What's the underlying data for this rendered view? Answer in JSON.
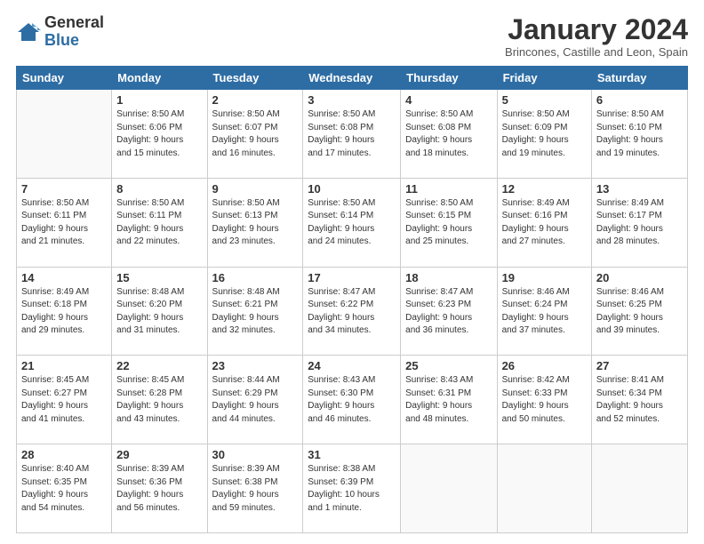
{
  "logo": {
    "general": "General",
    "blue": "Blue"
  },
  "header": {
    "month": "January 2024",
    "location": "Brincones, Castille and Leon, Spain"
  },
  "weekdays": [
    "Sunday",
    "Monday",
    "Tuesday",
    "Wednesday",
    "Thursday",
    "Friday",
    "Saturday"
  ],
  "weeks": [
    [
      {
        "day": null,
        "info": null
      },
      {
        "day": "1",
        "info": "Sunrise: 8:50 AM\nSunset: 6:06 PM\nDaylight: 9 hours\nand 15 minutes."
      },
      {
        "day": "2",
        "info": "Sunrise: 8:50 AM\nSunset: 6:07 PM\nDaylight: 9 hours\nand 16 minutes."
      },
      {
        "day": "3",
        "info": "Sunrise: 8:50 AM\nSunset: 6:08 PM\nDaylight: 9 hours\nand 17 minutes."
      },
      {
        "day": "4",
        "info": "Sunrise: 8:50 AM\nSunset: 6:08 PM\nDaylight: 9 hours\nand 18 minutes."
      },
      {
        "day": "5",
        "info": "Sunrise: 8:50 AM\nSunset: 6:09 PM\nDaylight: 9 hours\nand 19 minutes."
      },
      {
        "day": "6",
        "info": "Sunrise: 8:50 AM\nSunset: 6:10 PM\nDaylight: 9 hours\nand 19 minutes."
      }
    ],
    [
      {
        "day": "7",
        "info": ""
      },
      {
        "day": "8",
        "info": "Sunrise: 8:50 AM\nSunset: 6:11 PM\nDaylight: 9 hours\nand 22 minutes."
      },
      {
        "day": "9",
        "info": "Sunrise: 8:50 AM\nSunset: 6:13 PM\nDaylight: 9 hours\nand 23 minutes."
      },
      {
        "day": "10",
        "info": "Sunrise: 8:50 AM\nSunset: 6:14 PM\nDaylight: 9 hours\nand 24 minutes."
      },
      {
        "day": "11",
        "info": "Sunrise: 8:50 AM\nSunset: 6:15 PM\nDaylight: 9 hours\nand 25 minutes."
      },
      {
        "day": "12",
        "info": "Sunrise: 8:49 AM\nSunset: 6:16 PM\nDaylight: 9 hours\nand 27 minutes."
      },
      {
        "day": "13",
        "info": "Sunrise: 8:49 AM\nSunset: 6:17 PM\nDaylight: 9 hours\nand 28 minutes."
      }
    ],
    [
      {
        "day": "14",
        "info": ""
      },
      {
        "day": "15",
        "info": "Sunrise: 8:48 AM\nSunset: 6:20 PM\nDaylight: 9 hours\nand 31 minutes."
      },
      {
        "day": "16",
        "info": "Sunrise: 8:48 AM\nSunset: 6:21 PM\nDaylight: 9 hours\nand 32 minutes."
      },
      {
        "day": "17",
        "info": "Sunrise: 8:47 AM\nSunset: 6:22 PM\nDaylight: 9 hours\nand 34 minutes."
      },
      {
        "day": "18",
        "info": "Sunrise: 8:47 AM\nSunset: 6:23 PM\nDaylight: 9 hours\nand 36 minutes."
      },
      {
        "day": "19",
        "info": "Sunrise: 8:46 AM\nSunset: 6:24 PM\nDaylight: 9 hours\nand 37 minutes."
      },
      {
        "day": "20",
        "info": "Sunrise: 8:46 AM\nSunset: 6:25 PM\nDaylight: 9 hours\nand 39 minutes."
      }
    ],
    [
      {
        "day": "21",
        "info": ""
      },
      {
        "day": "22",
        "info": "Sunrise: 8:45 AM\nSunset: 6:28 PM\nDaylight: 9 hours\nand 43 minutes."
      },
      {
        "day": "23",
        "info": "Sunrise: 8:44 AM\nSunset: 6:29 PM\nDaylight: 9 hours\nand 44 minutes."
      },
      {
        "day": "24",
        "info": "Sunrise: 8:43 AM\nSunset: 6:30 PM\nDaylight: 9 hours\nand 46 minutes."
      },
      {
        "day": "25",
        "info": "Sunrise: 8:43 AM\nSunset: 6:31 PM\nDaylight: 9 hours\nand 48 minutes."
      },
      {
        "day": "26",
        "info": "Sunrise: 8:42 AM\nSunset: 6:33 PM\nDaylight: 9 hours\nand 50 minutes."
      },
      {
        "day": "27",
        "info": "Sunrise: 8:41 AM\nSunset: 6:34 PM\nDaylight: 9 hours\nand 52 minutes."
      }
    ],
    [
      {
        "day": "28",
        "info": ""
      },
      {
        "day": "29",
        "info": "Sunrise: 8:39 AM\nSunset: 6:36 PM\nDaylight: 9 hours\nand 56 minutes."
      },
      {
        "day": "30",
        "info": "Sunrise: 8:39 AM\nSunset: 6:38 PM\nDaylight: 9 hours\nand 59 minutes."
      },
      {
        "day": "31",
        "info": "Sunrise: 8:38 AM\nSunset: 6:39 PM\nDaylight: 10 hours\nand 1 minute."
      },
      {
        "day": null,
        "info": null
      },
      {
        "day": null,
        "info": null
      },
      {
        "day": null,
        "info": null
      }
    ]
  ],
  "week1_sun_info": "Sunrise: 8:50 AM\nSunset: 6:11 PM\nDaylight: 9 hours\nand 21 minutes.",
  "week2_sun_info": "Sunrise: 8:49 AM\nSunset: 6:18 PM\nDaylight: 9 hours\nand 29 minutes.",
  "week3_sun_info": "Sunrise: 8:45 AM\nSunset: 6:27 PM\nDaylight: 9 hours\nand 41 minutes.",
  "week4_sun_info": "Sunrise: 8:40 AM\nSunset: 6:35 PM\nDaylight: 9 hours\nand 54 minutes."
}
